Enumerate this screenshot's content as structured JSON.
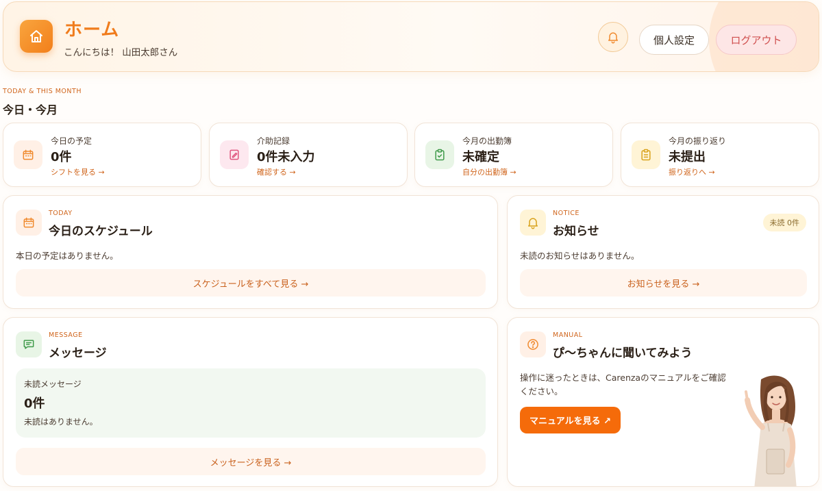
{
  "header": {
    "title": "ホーム",
    "greeting": "こんにちは！ 山田太郎さん",
    "settings_label": "個人設定",
    "logout_label": "ログアウト",
    "icons": {
      "home": "home-icon",
      "bell": "bell-icon"
    },
    "accent_color": "#f07c1c"
  },
  "section": {
    "kicker": "TODAY & THIS MONTH",
    "title": "今日・今月"
  },
  "stats": [
    {
      "label": "今日の予定",
      "value": "0件",
      "link": "シフトを見る →",
      "icon": "calendar-icon",
      "color": "#fff0e6"
    },
    {
      "label": "介助記録",
      "value": "0件未入力",
      "link": "確認する →",
      "icon": "edit-note-icon",
      "color": "#fde8ef"
    },
    {
      "label": "今月の出勤簿",
      "value": "未確定",
      "link": "自分の出勤簿 →",
      "icon": "clipboard-check-icon",
      "color": "#e8f5e6"
    },
    {
      "label": "今月の振り返り",
      "value": "未提出",
      "link": "振り返りへ →",
      "icon": "clipboard-list-icon",
      "color": "#fff4d6"
    }
  ],
  "schedule": {
    "kicker": "TODAY",
    "title": "今日のスケジュール",
    "text": "本日の予定はありません。",
    "link": "スケジュールをすべて見る →"
  },
  "notice": {
    "kicker": "NOTICE",
    "title": "お知らせ",
    "badge": "未読 0件",
    "text": "未読のお知らせはありません。",
    "link": "お知らせを見る →"
  },
  "message": {
    "kicker": "MESSAGE",
    "title": "メッセージ",
    "unread_label": "未読メッセージ",
    "unread_count": "0件",
    "unread_none": "未読はありません。",
    "link": "メッセージを見る →"
  },
  "manual": {
    "kicker": "MANUAL",
    "title": "ぴ〜ちゃんに聞いてみよう",
    "text_line1": "操作に迷ったときは、Carenzaのマニュアルをご確認",
    "text_line2": "ください。",
    "button": "マニュアルを見る ↗"
  }
}
